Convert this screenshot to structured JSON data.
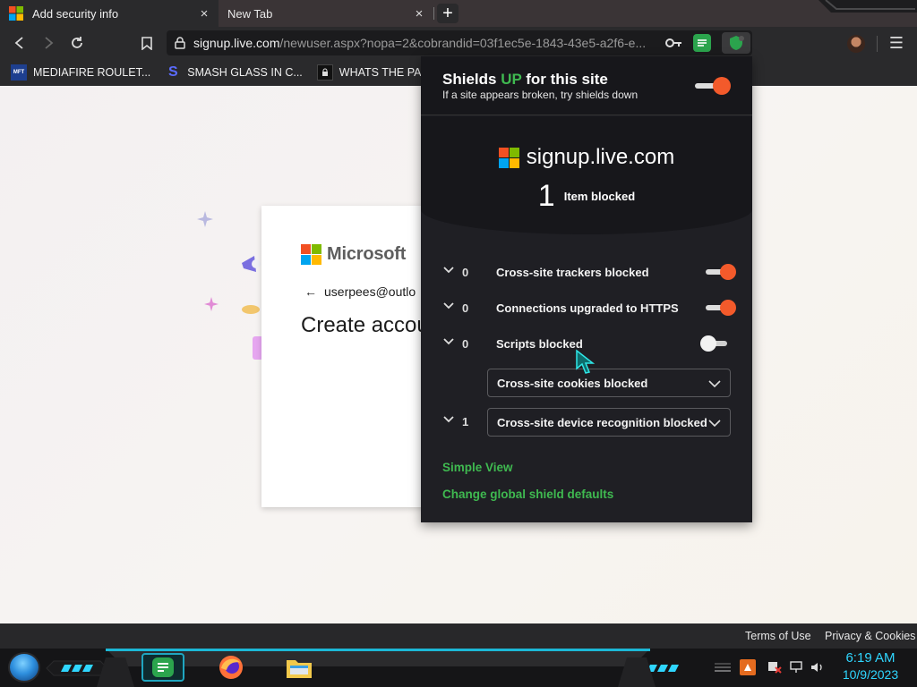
{
  "browser": {
    "tabs": [
      {
        "title": "Add security info",
        "close": "×",
        "active": true
      },
      {
        "title": "New Tab",
        "close": "×",
        "active": false
      }
    ],
    "new_tab_label": "+",
    "url_host": "signup.live.com",
    "url_path": "/newuser.aspx?nopa=2&cobrandid=03f1ec5e-1843-43e5-a2f6-e...",
    "menu_label": "☰"
  },
  "bookmarks": [
    {
      "label": "MEDIAFIRE ROULET...",
      "icon_text": "MFT"
    },
    {
      "label": "SMASH GLASS IN C...",
      "icon_text": "S"
    },
    {
      "label": "WHATS THE PASS...",
      "icon_text": ""
    }
  ],
  "page": {
    "brand": "Microsoft",
    "email": "userpees@outlo",
    "heading": "Create accou",
    "back_arrow": "←"
  },
  "shields": {
    "title_prefix": "Shields ",
    "title_status": "UP",
    "title_suffix": " for this site",
    "subtitle": "If a site appears broken, try shields down",
    "site": "signup.live.com",
    "blocked_count": "1",
    "blocked_label": "Item blocked",
    "rows": [
      {
        "count": "0",
        "label": "Cross-site trackers blocked",
        "enabled": true
      },
      {
        "count": "0",
        "label": "Connections upgraded to HTTPS",
        "enabled": true
      },
      {
        "count": "0",
        "label": "Scripts blocked",
        "enabled": false
      }
    ],
    "cookies_select": "Cross-site cookies blocked",
    "fingerprint_count": "1",
    "fingerprint_select": "Cross-site device recognition blocked",
    "simple_view": "Simple View",
    "global_defaults": "Change global shield defaults",
    "accent_color": "#3fb950",
    "toggle_on_color": "#f35a2b"
  },
  "footer": {
    "terms": "Terms of Use",
    "privacy": "Privacy & Cookies"
  },
  "taskbar": {
    "time": "6:19 AM",
    "date": "10/9/2023"
  }
}
